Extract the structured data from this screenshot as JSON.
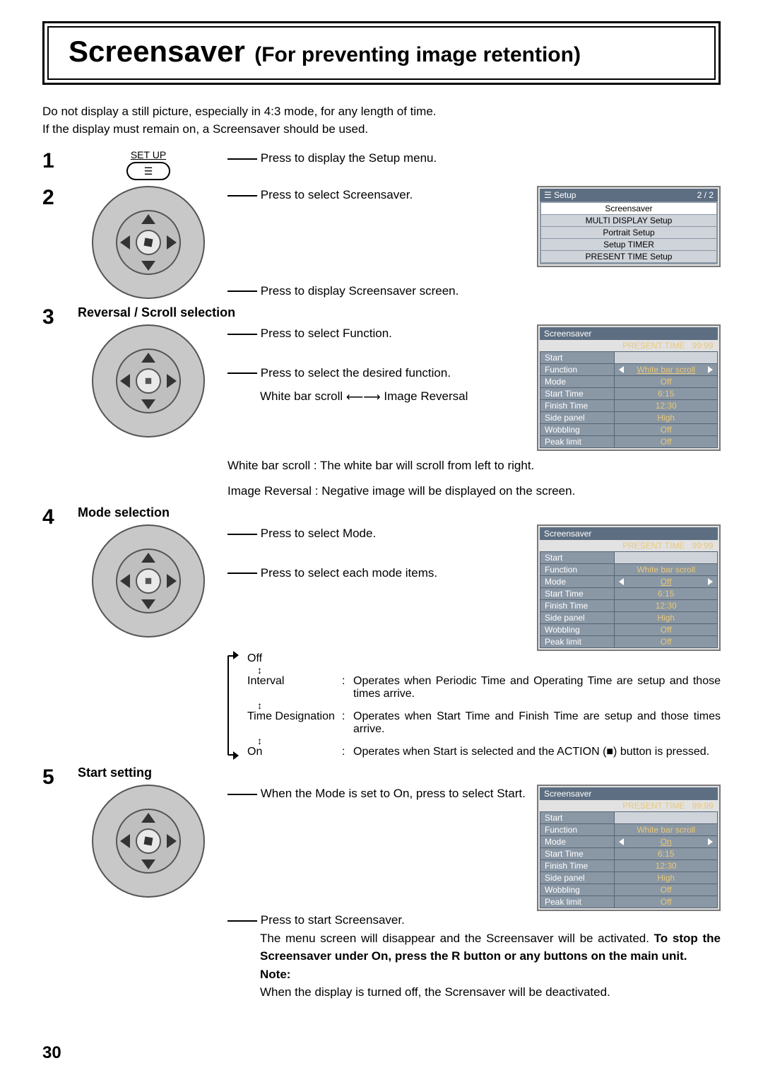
{
  "title_main": "Screensaver",
  "title_sub": "(For preventing image retention)",
  "intro_l1": "Do not display a still picture, especially in 4:3 mode, for any length of time.",
  "intro_l2": "If the display must remain on, a Screensaver should be used.",
  "setup_label": "SET UP",
  "step1": {
    "num": "1",
    "text": "Press to display the Setup menu."
  },
  "step2": {
    "num": "2",
    "text_top": "Press to select Screensaver.",
    "text_bottom": "Press to display Screensaver screen."
  },
  "setup_panel": {
    "title": "Setup",
    "page": "2 / 2",
    "items": [
      "Screensaver",
      "MULTI DISPLAY Setup",
      "Portrait Setup",
      "Setup TIMER",
      "PRESENT TIME Setup"
    ]
  },
  "step3": {
    "num": "3",
    "heading": "Reversal / Scroll selection",
    "l1": "Press to select Function.",
    "l2": "Press to select the desired function.",
    "toggle_left": "White bar scroll",
    "toggle_right": "Image Reversal",
    "l3": "White bar scroll : The white bar will scroll from left to right.",
    "l4": "Image Reversal : Negative image will be displayed on the screen."
  },
  "ss_panel_a": {
    "title": "Screensaver",
    "present_label": "PRESENT  TIME",
    "present_val": "99:99",
    "rows": [
      {
        "label": "Start",
        "value": "",
        "type": "btn"
      },
      {
        "label": "Function",
        "value": "White bar scroll",
        "type": "sel"
      },
      {
        "label": "Mode",
        "value": "Off",
        "type": "val"
      },
      {
        "label": "Start Time",
        "value": "6:15",
        "type": "val"
      },
      {
        "label": "Finish Time",
        "value": "12:30",
        "type": "val"
      },
      {
        "label": "Side panel",
        "value": "High",
        "type": "val"
      },
      {
        "label": "Wobbling",
        "value": "Off",
        "type": "val"
      },
      {
        "label": "Peak limit",
        "value": "Off",
        "type": "val"
      }
    ]
  },
  "step4": {
    "num": "4",
    "heading": "Mode selection",
    "l1": "Press to select Mode.",
    "l2": "Press to select each mode items.",
    "modes": {
      "off": "Off",
      "interval": {
        "k": "Interval",
        "d": "Operates when Periodic Time and Operating Time are setup and those times arrive."
      },
      "timedes": {
        "k": "Time Designation",
        "d": "Operates when Start Time and Finish Time are setup and those times arrive."
      },
      "on": {
        "k": "On",
        "d": "Operates when Start is selected and the ACTION (■) button is pressed."
      }
    }
  },
  "ss_panel_b": {
    "title": "Screensaver",
    "present_label": "PRESENT  TIME",
    "present_val": "99:99",
    "rows": [
      {
        "label": "Start",
        "value": "",
        "type": "btn"
      },
      {
        "label": "Function",
        "value": "White bar scroll",
        "type": "val"
      },
      {
        "label": "Mode",
        "value": "Off",
        "type": "sel"
      },
      {
        "label": "Start Time",
        "value": "6:15",
        "type": "val"
      },
      {
        "label": "Finish Time",
        "value": "12:30",
        "type": "val"
      },
      {
        "label": "Side panel",
        "value": "High",
        "type": "val"
      },
      {
        "label": "Wobbling",
        "value": "Off",
        "type": "val"
      },
      {
        "label": "Peak limit",
        "value": "Off",
        "type": "val"
      }
    ]
  },
  "step5": {
    "num": "5",
    "heading": "Start setting",
    "l1": "When the Mode is set to On, press to select Start.",
    "l2": "Press to start Screensaver.",
    "l3a": "The menu screen will disappear and the Screensaver will be activated. ",
    "l3b": "To stop the Screensaver under On, press the R button or any buttons on the main unit.",
    "note_label": "Note:",
    "l4": "When the display is turned off, the Scrensaver will be deactivated."
  },
  "ss_panel_c": {
    "title": "Screensaver",
    "present_label": "PRESENT  TIME",
    "present_val": "99:99",
    "rows": [
      {
        "label": "Start",
        "value": "",
        "type": "btn"
      },
      {
        "label": "Function",
        "value": "White bar scroll",
        "type": "val"
      },
      {
        "label": "Mode",
        "value": "On",
        "type": "sel"
      },
      {
        "label": "Start Time",
        "value": "6:15",
        "type": "val"
      },
      {
        "label": "Finish Time",
        "value": "12:30",
        "type": "val"
      },
      {
        "label": "Side panel",
        "value": "High",
        "type": "val"
      },
      {
        "label": "Wobbling",
        "value": "Off",
        "type": "val"
      },
      {
        "label": "Peak limit",
        "value": "Off",
        "type": "val"
      }
    ]
  },
  "page_number": "30"
}
